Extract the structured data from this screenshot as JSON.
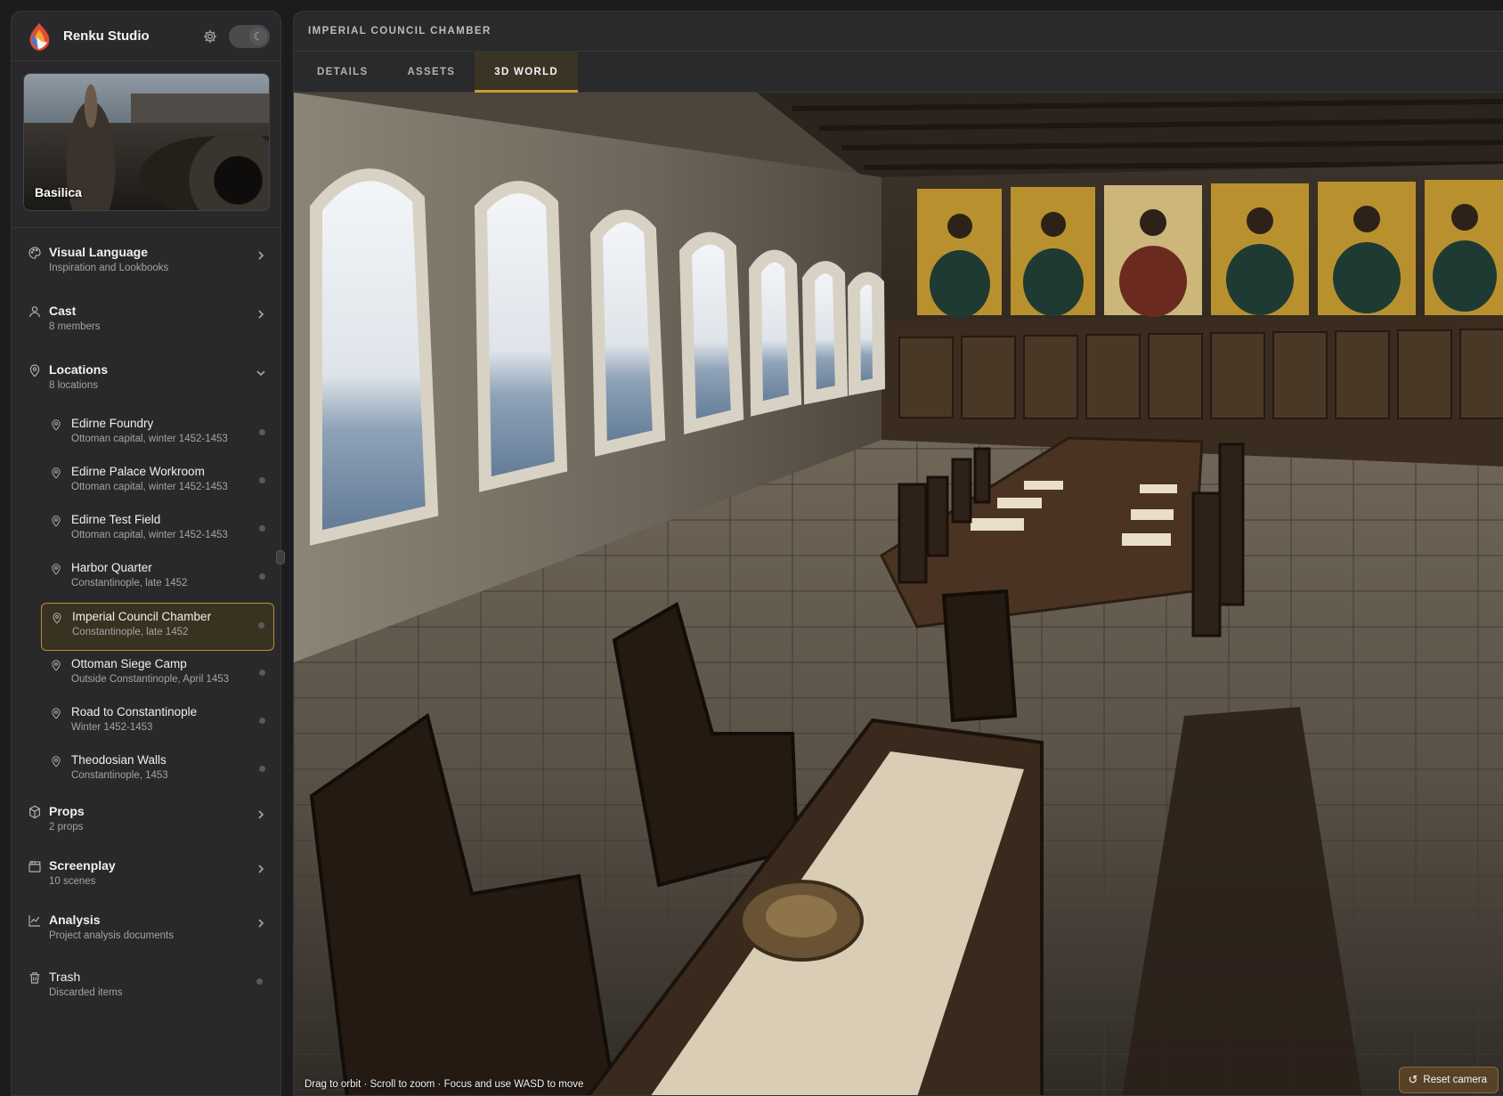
{
  "app": {
    "name": "Renku Studio"
  },
  "project": {
    "title": "Basilica"
  },
  "sidebar": {
    "sections": [
      {
        "id": "visual-language",
        "icon": "palette-icon",
        "title": "Visual Language",
        "subtitle": "Inspiration and Lookbooks"
      },
      {
        "id": "cast",
        "icon": "user-icon",
        "title": "Cast",
        "subtitle": "8 members"
      },
      {
        "id": "locations",
        "icon": "location-pin-icon",
        "title": "Locations",
        "subtitle": "8 locations",
        "expanded": true
      }
    ],
    "locations": [
      {
        "title": "Edirne Foundry",
        "subtitle": "Ottoman capital, winter 1452-1453"
      },
      {
        "title": "Edirne Palace Workroom",
        "subtitle": "Ottoman capital, winter 1452-1453"
      },
      {
        "title": "Edirne Test Field",
        "subtitle": "Ottoman capital, winter 1452-1453"
      },
      {
        "title": "Harbor Quarter",
        "subtitle": "Constantinople, late 1452"
      },
      {
        "title": "Imperial Council Chamber",
        "subtitle": "Constantinople, late 1452",
        "active": true
      },
      {
        "title": "Ottoman Siege Camp",
        "subtitle": "Outside Constantinople, April 1453"
      },
      {
        "title": "Road to Constantinople",
        "subtitle": "Winter 1452-1453"
      },
      {
        "title": "Theodosian Walls",
        "subtitle": "Constantinople, 1453"
      }
    ],
    "lower_sections": [
      {
        "id": "props",
        "icon": "box-icon",
        "title": "Props",
        "subtitle": "2 props"
      },
      {
        "id": "screenplay",
        "icon": "clapperboard-icon",
        "title": "Screenplay",
        "subtitle": "10 scenes"
      },
      {
        "id": "analysis",
        "icon": "chart-icon",
        "title": "Analysis",
        "subtitle": "Project analysis documents"
      },
      {
        "id": "trash",
        "icon": "trash-icon",
        "title": "Trash",
        "subtitle": "Discarded items"
      }
    ]
  },
  "main": {
    "title": "IMPERIAL COUNCIL CHAMBER",
    "tabs": [
      {
        "label": "DETAILS",
        "active": false
      },
      {
        "label": "ASSETS",
        "active": false
      },
      {
        "label": "3D WORLD",
        "active": true
      }
    ],
    "viewport": {
      "hint": "Drag to orbit · Scroll to zoom · Focus and use WASD to move",
      "reset_label": "Reset camera"
    }
  },
  "colors": {
    "accent": "#c99a3b",
    "active_bg": "#3a3220",
    "panel": "#29292b",
    "background": "#1c1c1e"
  }
}
